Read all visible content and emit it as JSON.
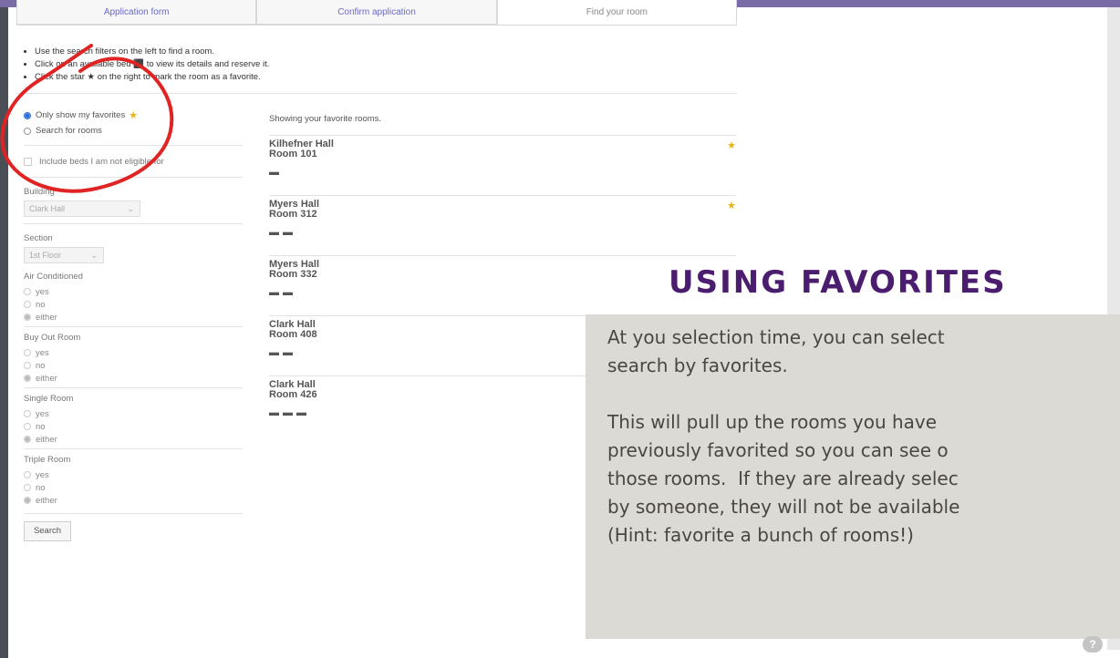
{
  "tabs": [
    {
      "label": "Application form"
    },
    {
      "label": "Confirm application"
    },
    {
      "label": "Find your room"
    }
  ],
  "instructions": [
    "Use the search filters on the left to find a room.",
    "Click on an available bed ⬛ to view its details and reserve it.",
    "Click the star ★ on the right to mark the room as a favorite."
  ],
  "sidebar": {
    "mode_options": [
      {
        "label": "Only show my favorites",
        "selected": true
      },
      {
        "label": "Search for rooms",
        "selected": false
      }
    ],
    "include_beds_label": "Include beds I am not eligible for",
    "building": {
      "label": "Building",
      "value": "Clark Hall"
    },
    "section": {
      "label": "Section",
      "value": "1st Floor"
    },
    "filters": [
      {
        "label": "Air Conditioned",
        "options": [
          "yes",
          "no",
          "either"
        ],
        "selected": "either"
      },
      {
        "label": "Buy Out Room",
        "options": [
          "yes",
          "no",
          "either"
        ],
        "selected": "either"
      },
      {
        "label": "Single Room",
        "options": [
          "yes",
          "no",
          "either"
        ],
        "selected": "either"
      },
      {
        "label": "Triple Room",
        "options": [
          "yes",
          "no",
          "either"
        ],
        "selected": "either"
      }
    ],
    "search_button": "Search"
  },
  "main": {
    "showing_text": "Showing your favorite rooms.",
    "rooms": [
      {
        "building": "Kilhefner Hall",
        "room": "Room 101",
        "beds": 1,
        "starred": true
      },
      {
        "building": "Myers Hall",
        "room": "Room 312",
        "beds": 2,
        "starred": true
      },
      {
        "building": "Myers Hall",
        "room": "Room 332",
        "beds": 2,
        "starred": false
      },
      {
        "building": "Clark Hall",
        "room": "Room 408",
        "beds": 2,
        "starred": false
      },
      {
        "building": "Clark Hall",
        "room": "Room 426",
        "beds": 3,
        "starred": false
      }
    ]
  },
  "overlay": {
    "title": "USING FAVORITES",
    "body": "At you selection time, you can select\nsearch by favorites.\n\nThis will pull up the rooms you have\npreviously favorited so you can see o\nthose rooms.  If they are already selec\nby someone, they will not be available\n(Hint: favorite a bunch of rooms!)"
  },
  "colors": {
    "overlay_title": "#4b1d6e",
    "overlay_bg": "#dcdad5",
    "annotation_red": "#e02424",
    "star": "#e7b416"
  }
}
